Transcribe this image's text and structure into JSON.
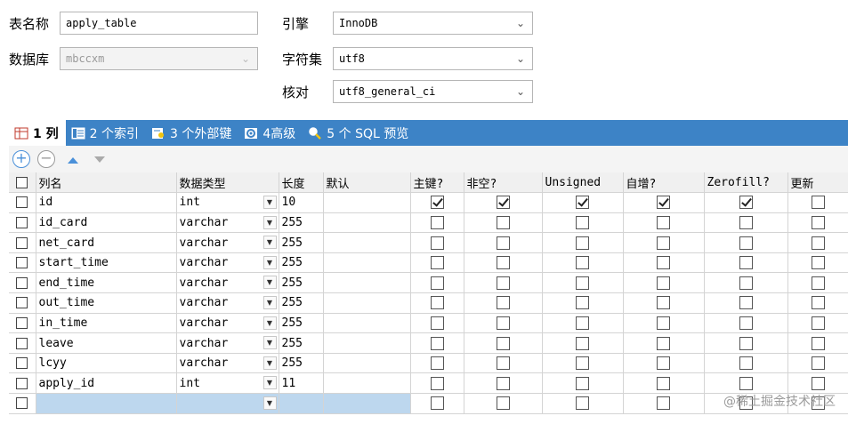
{
  "form": {
    "table_name_label": "表名称",
    "table_name_value": "apply_table",
    "database_label": "数据库",
    "database_value": "mbccxm",
    "engine_label": "引擎",
    "engine_value": "InnoDB",
    "charset_label": "字符集",
    "charset_value": "utf8",
    "collation_label": "核对",
    "collation_value": "utf8_general_ci"
  },
  "tabs": [
    {
      "label": "1 列",
      "icon": "columns-icon"
    },
    {
      "label": "2 个索引",
      "icon": "index-icon"
    },
    {
      "label": "3 个外部键",
      "icon": "foreign-key-icon"
    },
    {
      "label": "4高级",
      "icon": "advanced-icon"
    },
    {
      "label": "5 个 SQL 预览",
      "icon": "magnifier-icon"
    }
  ],
  "toolbar": {
    "add_icon": "plus-circle-icon",
    "remove_icon": "minus-circle-icon",
    "move_up_icon": "arrow-up-icon",
    "move_down_icon": "arrow-down-icon"
  },
  "grid": {
    "headers": [
      "列名",
      "数据类型",
      "长度",
      "默认",
      "主键?",
      "非空?",
      "Unsigned",
      "自增?",
      "Zerofill?",
      "更新"
    ],
    "rows": [
      {
        "name": "id",
        "type": "int",
        "length": "10",
        "default": "",
        "pk": true,
        "notnull": true,
        "unsigned": true,
        "autoinc": true,
        "zerofill": true,
        "update": false
      },
      {
        "name": "id_card",
        "type": "varchar",
        "length": "255",
        "default": "",
        "pk": false,
        "notnull": false,
        "unsigned": false,
        "autoinc": false,
        "zerofill": false,
        "update": false
      },
      {
        "name": "net_card",
        "type": "varchar",
        "length": "255",
        "default": "",
        "pk": false,
        "notnull": false,
        "unsigned": false,
        "autoinc": false,
        "zerofill": false,
        "update": false
      },
      {
        "name": "start_time",
        "type": "varchar",
        "length": "255",
        "default": "",
        "pk": false,
        "notnull": false,
        "unsigned": false,
        "autoinc": false,
        "zerofill": false,
        "update": false
      },
      {
        "name": "end_time",
        "type": "varchar",
        "length": "255",
        "default": "",
        "pk": false,
        "notnull": false,
        "unsigned": false,
        "autoinc": false,
        "zerofill": false,
        "update": false
      },
      {
        "name": "out_time",
        "type": "varchar",
        "length": "255",
        "default": "",
        "pk": false,
        "notnull": false,
        "unsigned": false,
        "autoinc": false,
        "zerofill": false,
        "update": false
      },
      {
        "name": "in_time",
        "type": "varchar",
        "length": "255",
        "default": "",
        "pk": false,
        "notnull": false,
        "unsigned": false,
        "autoinc": false,
        "zerofill": false,
        "update": false
      },
      {
        "name": "leave",
        "type": "varchar",
        "length": "255",
        "default": "",
        "pk": false,
        "notnull": false,
        "unsigned": false,
        "autoinc": false,
        "zerofill": false,
        "update": false
      },
      {
        "name": "lcyy",
        "type": "varchar",
        "length": "255",
        "default": "",
        "pk": false,
        "notnull": false,
        "unsigned": false,
        "autoinc": false,
        "zerofill": false,
        "update": false
      },
      {
        "name": "apply_id",
        "type": "int",
        "length": "11",
        "default": "",
        "pk": false,
        "notnull": false,
        "unsigned": false,
        "autoinc": false,
        "zerofill": false,
        "update": false
      },
      {
        "name": "",
        "type": "",
        "length": "",
        "default": "",
        "pk": false,
        "notnull": false,
        "unsigned": false,
        "autoinc": false,
        "zerofill": false,
        "update": false
      }
    ]
  },
  "watermark": "@稀土掘金技术社区",
  "colors": {
    "tab_bar": "#3d83c6",
    "new_row": "#bdd7ee"
  }
}
